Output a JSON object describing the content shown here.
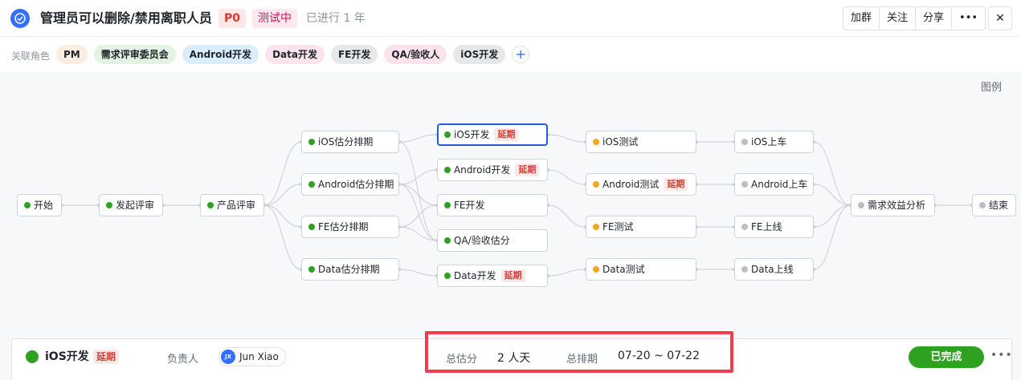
{
  "header": {
    "title": "管理员可以删除/禁用离职人员",
    "priority": "P0",
    "status": "测试中",
    "elapsed": "已进行 1 年",
    "buttons": [
      "加群",
      "关注",
      "分享",
      "•••"
    ],
    "close": "✕"
  },
  "roles": {
    "label": "关联角色",
    "items": [
      {
        "label": "PM",
        "bg": "#fbeee0"
      },
      {
        "label": "需求评审委员会",
        "bg": "#e2f3e3"
      },
      {
        "label": "Android开发",
        "bg": "#d9eefa"
      },
      {
        "label": "Data开发",
        "bg": "#fbe3ec"
      },
      {
        "label": "FE开发",
        "bg": "#e6e7e9"
      },
      {
        "label": "QA/验收人",
        "bg": "#fbe3ec"
      },
      {
        "label": "iOS开发",
        "bg": "#e6e7e9"
      }
    ],
    "add": "+"
  },
  "legend": "图例",
  "delay_label": "延期",
  "nodes": {
    "start": "开始",
    "review_start": "发起评审",
    "product_review": "产品评审",
    "ios_est": "iOS估分排期",
    "android_est": "Android估分排期",
    "fe_est": "FE估分排期",
    "data_est": "Data估分排期",
    "ios_dev": "iOS开发",
    "android_dev": "Android开发",
    "fe_dev": "FE开发",
    "qa_est": "QA/验收估分",
    "data_dev": "Data开发",
    "ios_test": "iOS测试",
    "android_test": "Android测试",
    "fe_test": "FE测试",
    "data_test": "Data测试",
    "ios_release": "iOS上车",
    "android_release": "Android上车",
    "fe_release": "FE上线",
    "data_release": "Data上线",
    "benefit": "需求效益分析",
    "end": "结束"
  },
  "detail": {
    "name": "iOS开发",
    "delay": "延期",
    "owner_label": "负责人",
    "owner_initials": "JX",
    "owner_name": "Jun Xiao",
    "estimate_label": "总估分",
    "estimate_value": "2 人天",
    "schedule_label": "总排期",
    "schedule_value": "07-20 ~ 07-22",
    "done_button": "已完成",
    "more": "•••"
  }
}
